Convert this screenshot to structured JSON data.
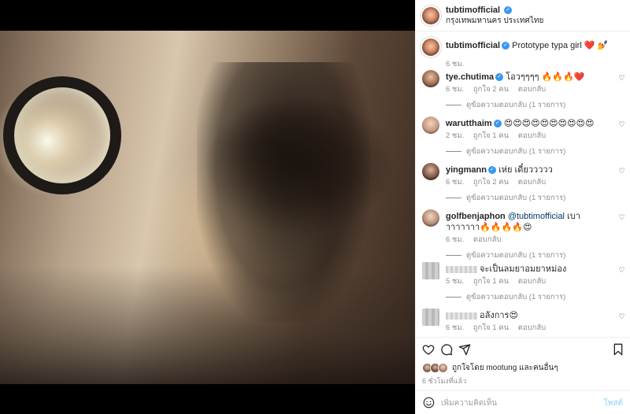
{
  "header": {
    "username": "tubtimofficial",
    "location": "กรุงเทพมหานคร ประเทศไทย"
  },
  "caption": {
    "username": "tubtimofficial",
    "text": "Prototype typa girl ❤️ 💅",
    "time": "6 ชม."
  },
  "comments": [
    {
      "username": "tye.chutima",
      "verified": true,
      "text": "โอวๆๆๆๆ 🔥🔥🔥❤️",
      "time": "6 ชม.",
      "likes": "ถูกใจ 2 คน",
      "reply": "ตอบกลับ",
      "view_replies": "ดูข้อความตอบกลับ (1 รายการ)"
    },
    {
      "username": "warutthaim",
      "verified": true,
      "text": "😍😍😍😍😍😍😍😍😍😍",
      "time": "2 ชม.",
      "likes": "ถูกใจ 1 คน",
      "reply": "ตอบกลับ",
      "view_replies": "ดูข้อความตอบกลับ (1 รายการ)"
    },
    {
      "username": "yingmann",
      "verified": true,
      "text": "เห่ย เดี๋ยววววว",
      "time": "6 ชม.",
      "likes": "ถูกใจ 2 คน",
      "reply": "ตอบกลับ",
      "view_replies": "ดูข้อความตอบกลับ (1 รายการ)"
    },
    {
      "username": "golfbenjaphon",
      "verified": false,
      "mention": "@tubtimofficial",
      "text": "เบาาาาาาาา🔥🔥🔥🔥😍",
      "time": "6 ชม.",
      "likes": "",
      "reply": "ตอบกลับ",
      "view_replies": "ดูข้อความตอบกลับ (1 รายการ)"
    },
    {
      "username": "",
      "verified": false,
      "text": "จะเป็นลมยาอมยาหม่อง",
      "time": "5 ชม.",
      "likes": "ถูกใจ 1 คน",
      "reply": "ตอบกลับ",
      "view_replies": "ดูข้อความตอบกลับ (1 รายการ)"
    },
    {
      "username": "",
      "verified": false,
      "text": "อลังการ😍",
      "time": "6 ชม.",
      "likes": "ถูกใจ 1 คน",
      "reply": "ตอบกลับ",
      "view_replies": ""
    }
  ],
  "liked_by": "ถูกใจโดย mootung และคนอื่นๆ",
  "post_time": "6 ชั่วโมงที่แล้ว",
  "add_comment": {
    "placeholder": "เพิ่มความคิดเห็น",
    "post_label": "โพสต์"
  },
  "icons": {
    "like": "heart-icon",
    "comment": "comment-icon",
    "share": "share-icon",
    "save": "bookmark-icon",
    "emoji": "emoji-icon"
  },
  "colors": {
    "verified": "#3897f0",
    "post_button": "#b2dffc",
    "muted": "#8e8e8e"
  }
}
